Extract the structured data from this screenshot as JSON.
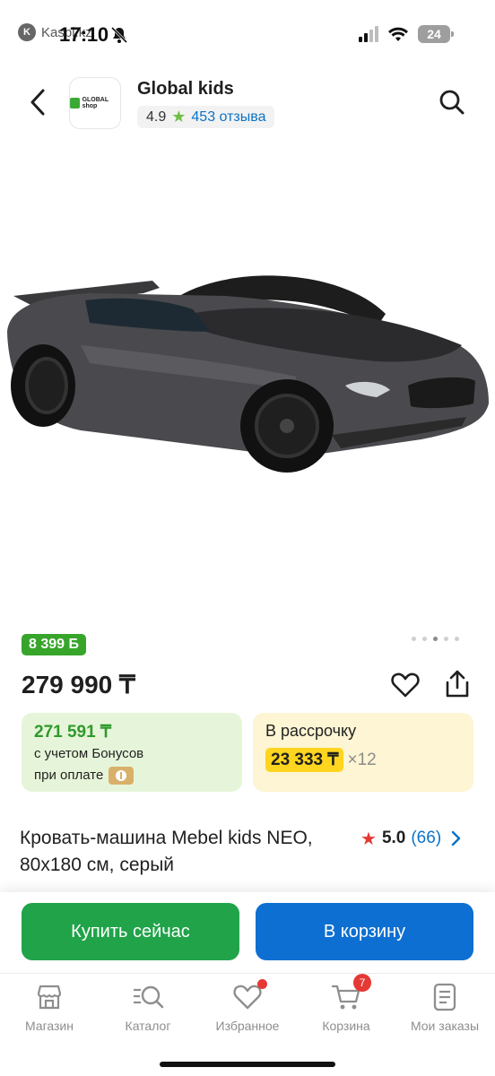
{
  "status_bar": {
    "app_name": "Kaspi.kz",
    "time": "17:10",
    "battery": "24"
  },
  "header": {
    "shop_name": "Global kids",
    "logo_text": "GLOBAL shop",
    "rating": "4.9",
    "reviews": "453 отзыва"
  },
  "product": {
    "image_icon": "car-bed-image",
    "bonus_badge": "8 399 Б",
    "price": "279 990 ₸",
    "bonus_card": {
      "amount": "271 591 ₸",
      "line1": "с учетом Бонусов",
      "line2": "при оплате"
    },
    "credit_card": {
      "title": "В рассрочку",
      "amount": "23 333 ₸",
      "times": "×12"
    },
    "title": "Кровать-машина Mebel kids NEO, 80x180 см, серый",
    "score": "5.0",
    "review_count": "(66)"
  },
  "actions": {
    "buy": "Купить сейчас",
    "cart": "В корзину"
  },
  "tabs": [
    {
      "label": "Магазин",
      "icon": "store-icon"
    },
    {
      "label": "Каталог",
      "icon": "catalog-search-icon"
    },
    {
      "label": "Избранное",
      "icon": "heart-icon"
    },
    {
      "label": "Корзина",
      "icon": "cart-icon",
      "badge": "7"
    },
    {
      "label": "Мои заказы",
      "icon": "orders-icon"
    }
  ],
  "colors": {
    "green": "#21a34a",
    "blue": "#0d6fd1",
    "yellow": "#ffd51f",
    "red": "#e53935"
  }
}
